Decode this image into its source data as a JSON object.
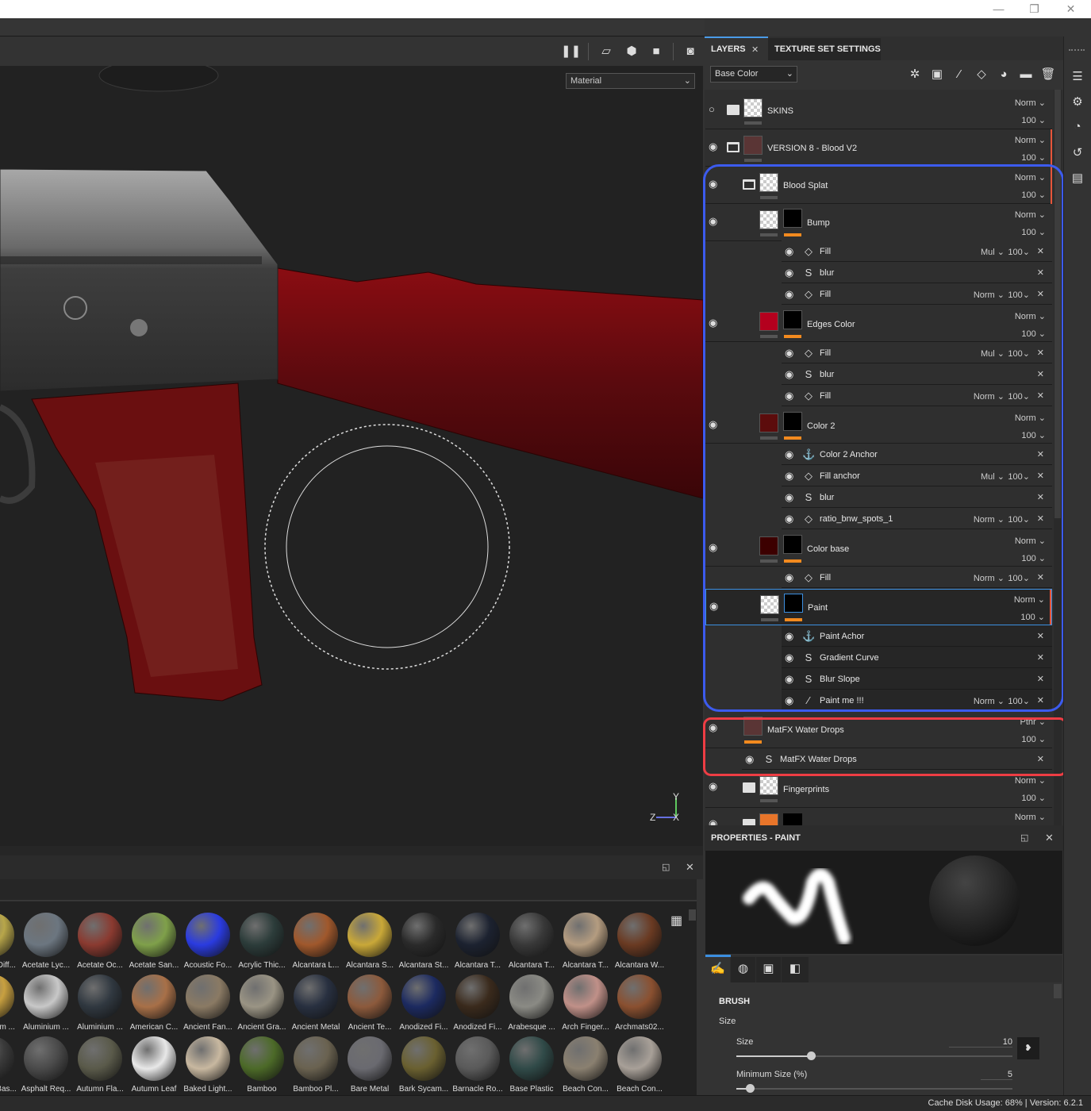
{
  "window": {
    "minimize_icon": "—",
    "restore_icon": "❐",
    "close_icon": "✕"
  },
  "viewport": {
    "display_mode": "Material",
    "axis_labels": {
      "x": "X",
      "y": "Y",
      "z": "Z"
    },
    "toolbar": [
      "pause-icon",
      "perspective-icon",
      "cube-icon",
      "camera-icon",
      "screenshot-icon"
    ]
  },
  "layers_panel": {
    "tabs": [
      {
        "label": "LAYERS",
        "active": true,
        "close": "✕"
      },
      {
        "label": "TEXTURE SET SETTINGS",
        "active": false
      }
    ],
    "channel": "Base Color",
    "toolbar_icons": [
      "magic-wand-icon",
      "add-fill-layer-icon",
      "paint-brush-icon",
      "fill-bucket-icon",
      "mask-icon",
      "folder-icon",
      "trash-icon"
    ],
    "layers": [
      {
        "name": "SKINS",
        "blend": "Norm",
        "opacity": "100",
        "visible": false,
        "type": "folder"
      },
      {
        "name": "VERSION 8 - Blood V2",
        "blend": "Norm",
        "opacity": "100",
        "visible": true,
        "type": "folder-open"
      },
      {
        "name": "Blood Splat",
        "blend": "Norm",
        "opacity": "100",
        "visible": true,
        "type": "folder-open"
      },
      {
        "name": "Bump",
        "blend": "Norm",
        "opacity": "100",
        "visible": true,
        "type": "fill",
        "effects": [
          {
            "name": "Fill",
            "icon": "fill",
            "blend": "Mul",
            "opacity": "100"
          },
          {
            "name": "blur",
            "icon": "substance"
          },
          {
            "name": "Fill",
            "icon": "fill",
            "blend": "Norm",
            "opacity": "100"
          }
        ]
      },
      {
        "name": "Edges Color",
        "blend": "Norm",
        "opacity": "100",
        "visible": true,
        "type": "fill",
        "color": "#b4001e",
        "effects": [
          {
            "name": "Fill",
            "icon": "fill",
            "blend": "Mul",
            "opacity": "100"
          },
          {
            "name": "blur",
            "icon": "substance"
          },
          {
            "name": "Fill",
            "icon": "fill",
            "blend": "Norm",
            "opacity": "100"
          }
        ]
      },
      {
        "name": "Color 2",
        "blend": "Norm",
        "opacity": "100",
        "visible": true,
        "type": "fill",
        "color": "#5c0c0c",
        "effects": [
          {
            "name": "Color 2 Anchor",
            "icon": "anchor"
          },
          {
            "name": "Fill anchor",
            "icon": "fill",
            "blend": "Mul",
            "opacity": "100"
          },
          {
            "name": "blur",
            "icon": "substance"
          },
          {
            "name": "ratio_bnw_spots_1",
            "icon": "fill",
            "blend": "Norm",
            "opacity": "100"
          }
        ]
      },
      {
        "name": "Color base",
        "blend": "Norm",
        "opacity": "100",
        "visible": true,
        "type": "fill",
        "color": "#3c0000",
        "effects": [
          {
            "name": "Fill",
            "icon": "fill",
            "blend": "Norm",
            "opacity": "100"
          }
        ]
      },
      {
        "name": "Paint",
        "blend": "Norm",
        "opacity": "100",
        "visible": true,
        "type": "paint",
        "selected": true,
        "effects": [
          {
            "name": "Paint Achor",
            "icon": "anchor"
          },
          {
            "name": "Gradient Curve",
            "icon": "substance"
          },
          {
            "name": "Blur Slope",
            "icon": "substance"
          },
          {
            "name": "Paint me !!!",
            "icon": "brush",
            "blend": "Norm",
            "opacity": "100"
          }
        ]
      },
      {
        "name": "MatFX Water Drops",
        "blend": "Pthr",
        "opacity": "100",
        "visible": true,
        "type": "smart",
        "effects": [
          {
            "name": "MatFX Water Drops",
            "icon": "substance"
          }
        ]
      },
      {
        "name": "Fingerprints",
        "blend": "Norm",
        "opacity": "100",
        "visible": true,
        "type": "folder"
      },
      {
        "name": "",
        "blend": "Norm",
        "opacity": "",
        "visible": true,
        "type": "folder"
      }
    ],
    "highlight_colors": {
      "blue": "#3c5bee",
      "red": "#ee3d44",
      "orange": "#f28a1f"
    }
  },
  "properties": {
    "title": "PROPERTIES - PAINT",
    "section": "BRUSH",
    "group": "Size",
    "size_label": "Size",
    "size_value": "10",
    "size_fraction": 0.27,
    "min_size_label": "Minimum Size (%)",
    "min_size_value": "5",
    "min_size_fraction": 0.05,
    "tabs": [
      "brush-tab",
      "alpha-tab",
      "stencil-tab",
      "material-tab"
    ]
  },
  "shelf": {
    "materials": [
      [
        "Acetate Diff...",
        "Acetate Lyc...",
        "Acetate Oc...",
        "Acetate San...",
        "Acoustic Fo...",
        "Acrylic Thic...",
        "Alcantara L...",
        "Alcantara S...",
        "Alcantara St...",
        "Alcantara T...",
        "Alcantara T...",
        "Alcantara T...",
        "Alcantara W..."
      ],
      [
        "Aluminium ...",
        "Aluminium ...",
        "Aluminium ...",
        "American C...",
        "Ancient Fan...",
        "Ancient Gra...",
        "Ancient Metal",
        "Ancient Te...",
        "Anodized Fi...",
        "Anodized Fi...",
        "Arabesque ...",
        "Arch Finger...",
        "Archmats02..."
      ],
      [
        "Asphalt Bas...",
        "Asphalt Req...",
        "Autumn Fla...",
        "Autumn Leaf",
        "Baked Light...",
        "Bamboo",
        "Bamboo Pl...",
        "Bare Metal",
        "Bark Sycam...",
        "Barnacle Ro...",
        "Base Plastic",
        "Beach Con...",
        "Beach Con..."
      ]
    ]
  },
  "status": {
    "text": "Cache Disk Usage:   68% | Version: 6.2.1"
  }
}
